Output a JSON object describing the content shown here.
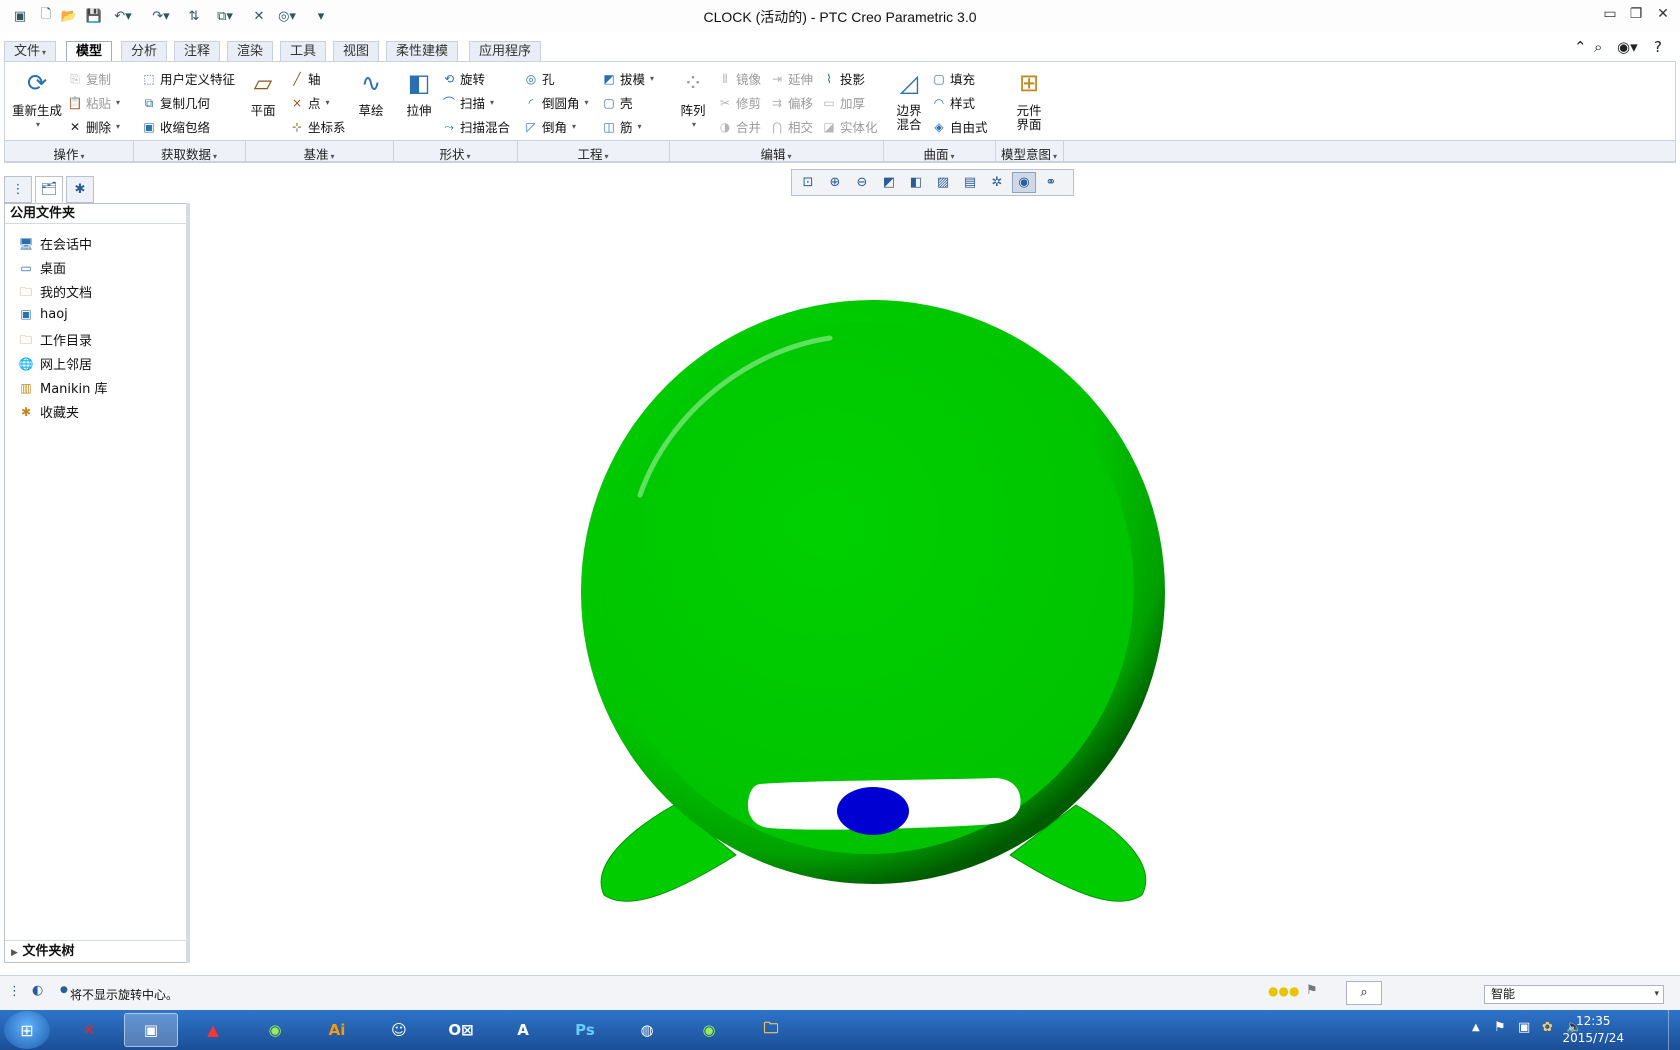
{
  "window": {
    "title": "CLOCK (活动的) - PTC Creo Parametric 3.0"
  },
  "menu_tabs": [
    "文件",
    "模型",
    "分析",
    "注释",
    "渲染",
    "工具",
    "视图",
    "柔性建模",
    "应用程序"
  ],
  "active_tab": "模型",
  "ribbon": {
    "operations": {
      "regenerate": "重新生成",
      "copy": "复制",
      "paste": "粘贴",
      "delete": "删除",
      "group_label": "操作"
    },
    "get_data": {
      "udf": "用户定义特征",
      "copy_geom": "复制几何",
      "shrinkwrap": "收缩包络",
      "group_label": "获取数据"
    },
    "datum": {
      "plane": "平面",
      "axis": "轴",
      "point": "点",
      "csys": "坐标系",
      "sketch": "草绘",
      "group_label": "基准"
    },
    "shapes": {
      "extrude": "拉伸",
      "revolve": "旋转",
      "sweep": "扫描",
      "swept_blend": "扫描混合",
      "group_label": "形状"
    },
    "engineering": {
      "hole": "孔",
      "round": "倒圆角",
      "chamfer": "倒角",
      "draft": "拔模",
      "shell": "壳",
      "rib": "筋",
      "group_label": "工程"
    },
    "editing": {
      "pattern": "阵列",
      "mirror": "镜像",
      "trim": "修剪",
      "merge": "合并",
      "extend": "延伸",
      "offset": "偏移",
      "intersect": "相交",
      "project": "投影",
      "thicken": "加厚",
      "solidify": "实体化",
      "group_label": "编辑"
    },
    "surfaces": {
      "boundary_blend_l1": "边界",
      "boundary_blend_l2": "混合",
      "fill": "填充",
      "style": "样式",
      "freestyle": "自由式",
      "group_label": "曲面"
    },
    "model_intent": {
      "component_interface_l1": "元件",
      "component_interface_l2": "界面",
      "group_label": "模型意图"
    }
  },
  "navigator": {
    "header": "公用文件夹",
    "items": [
      {
        "label": "在会话中",
        "icon": "monitor-icon"
      },
      {
        "label": "桌面",
        "icon": "desktop-icon"
      },
      {
        "label": "我的文档",
        "icon": "documents-icon"
      },
      {
        "label": "haoj",
        "icon": "computer-icon"
      },
      {
        "label": "工作目录",
        "icon": "folder-icon"
      },
      {
        "label": "网上邻居",
        "icon": "network-icon"
      },
      {
        "label": "Manikin 库",
        "icon": "library-icon"
      },
      {
        "label": "收藏夹",
        "icon": "favorites-icon"
      }
    ],
    "footer": "文件夹树"
  },
  "status": {
    "message": "将不显示旋转中心。",
    "filter": "智能"
  },
  "taskbar": {
    "time": "12:35",
    "date": "2015/7/24"
  },
  "colors": {
    "model_body": "#00c800",
    "model_dark": "#006400",
    "model_slot": "#ffffff",
    "model_eye": "#0000d2",
    "ribbon_border": "#c9d2de",
    "taskbar": "#1b4f97"
  }
}
